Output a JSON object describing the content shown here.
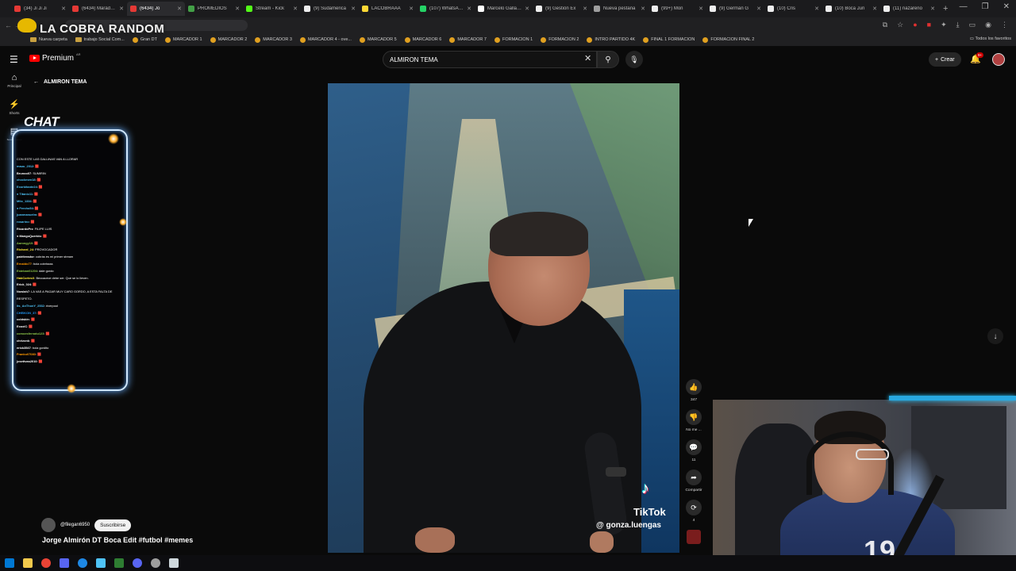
{
  "browser": {
    "tabs": [
      {
        "label": "(34) Ji Ji Ji",
        "color": "#e53935",
        "active": false
      },
      {
        "label": "(6434) Maradona",
        "color": "#e53935",
        "active": false
      },
      {
        "label": "(6434) Jo",
        "color": "#e53935",
        "active": true
      },
      {
        "label": "PROMEDIOS",
        "color": "#43a047",
        "active": false
      },
      {
        "label": "Stream - Kick",
        "color": "#53fc18",
        "active": false
      },
      {
        "label": "(9) Sudamerica",
        "color": "#eeeeee",
        "active": false
      },
      {
        "label": "LACOBRAAA",
        "color": "#fdd835",
        "active": false
      },
      {
        "label": "(107) WhatsApp",
        "color": "#25d366",
        "active": false
      },
      {
        "label": "Marcelo Gallardo",
        "color": "#ffffff",
        "active": false
      },
      {
        "label": "(9) Gestión Ex",
        "color": "#eeeeee",
        "active": false
      },
      {
        "label": "Nueva pestaña",
        "color": "#9e9e9e",
        "active": false
      },
      {
        "label": "(99+) Mon",
        "color": "#eeeeee",
        "active": false
      },
      {
        "label": "(9) Germán G",
        "color": "#eeeeee",
        "active": false
      },
      {
        "label": "(10) Cris",
        "color": "#eeeeee",
        "active": false
      },
      {
        "label": "(10) Boca Jun",
        "color": "#eeeeee",
        "active": false
      },
      {
        "label": "(11) nazareno",
        "color": "#eeeeee",
        "active": false
      }
    ],
    "new_tab": "+",
    "window_controls": [
      "—",
      "❐",
      "✕"
    ],
    "bookmarks": [
      {
        "label": "Nueva carpeta",
        "type": "folder"
      },
      {
        "label": "trabajo Social Com...",
        "type": "folder"
      },
      {
        "label": "Gran DT",
        "type": "site"
      },
      {
        "label": "MARCADOR 1",
        "type": "site"
      },
      {
        "label": "MARCADOR 2",
        "type": "site"
      },
      {
        "label": "MARCADOR 3",
        "type": "site"
      },
      {
        "label": "MARCADOR 4 - ove...",
        "type": "site"
      },
      {
        "label": "MARCADOR 5",
        "type": "site"
      },
      {
        "label": "MARCADOR 6",
        "type": "site"
      },
      {
        "label": "MARCADOR 7",
        "type": "site"
      },
      {
        "label": "FORMACION 1",
        "type": "site"
      },
      {
        "label": "FORMACION 2",
        "type": "site"
      },
      {
        "label": "INTRO PARTIDO 4K",
        "type": "site"
      },
      {
        "label": "FINAL 1 FORMACION",
        "type": "site"
      },
      {
        "label": "FORMACION FINAL 2",
        "type": "site"
      }
    ],
    "all_bookmarks": "Todos los favoritos"
  },
  "overlay": {
    "stream_title": "LA COBRA RANDOM",
    "chat_label": "CHAT",
    "chat_messages": [
      {
        "user": "",
        "text": "CON ESTE LAS GALLINAS VAN A LLORAR",
        "color": "#ffffff"
      },
      {
        "user": "mauu_2012",
        "text": ": 🟥",
        "color": "#4fc3f7"
      },
      {
        "user": "Brunoo07",
        "text": ": SUMIRIN",
        "color": "#ffffff"
      },
      {
        "user": "chockmen18",
        "text": ": 🟥",
        "color": "#4fc3f7"
      },
      {
        "user": "Exorbitante24",
        "text": ": 🟥",
        "color": "#4fc3f7"
      },
      {
        "user": "● Titanic11",
        "text": ": 🟥",
        "color": "#4fc3f7"
      },
      {
        "user": "Milo_1334",
        "text": ": 🟥",
        "color": "#4fc3f7"
      },
      {
        "user": "● Fercho54",
        "text": ": 🟥",
        "color": "#4fc3f7"
      },
      {
        "user": "juanmanuelm",
        "text": ": 🟥",
        "color": "#4fc3f7"
      },
      {
        "user": "rosarino",
        "text": ": 🟥",
        "color": "#4fc3f7"
      },
      {
        "user": "RicardoPrz",
        "text": ": FILIPE LUIS",
        "color": "#ffffff"
      },
      {
        "user": "● MangoQuerido",
        "text": ": 🟥",
        "color": "#ffffff"
      },
      {
        "user": "Aarongy10",
        "text": ": 🟥",
        "color": "#8bc34a"
      },
      {
        "user": "Richard_24",
        "text": ": PROVOCADOR",
        "color": "#ffeb3b"
      },
      {
        "user": "patriterador",
        "text": ": cobrás es mi primer stream",
        "color": "#ffffff"
      },
      {
        "user": "Ernaldo77",
        "text": ": bola cobrissss",
        "color": "#ff9800"
      },
      {
        "user": "Esteban01204",
        "text": ": dale gordo",
        "color": "#8bc34a"
      },
      {
        "user": "HabCortesX",
        "text": ": Beccacece debe ser. Que se lo lleven.",
        "color": "#ffeb3b"
      },
      {
        "user": "Erick_024",
        "text": ": 🟥",
        "color": "#ffffff"
      },
      {
        "user": "Nowlah7",
        "text": ": LA VAS A PAGAR MUY CARO GORDO, A ESTA FALTA DE",
        "color": "#ffffff"
      },
      {
        "user": "",
        "text": "RESPETO.",
        "color": "#ffffff"
      },
      {
        "user": "its_AnThonY_2532",
        "text": ": riverpool",
        "color": "#4fc3f7"
      },
      {
        "user": "CHEIKON_37",
        "text": ": 🟥",
        "color": "#2196f3"
      },
      {
        "user": "coldskin",
        "text": ": 🟥",
        "color": "#ffffff"
      },
      {
        "user": "ExoxiC",
        "text": ": 🟥",
        "color": "#ffffff"
      },
      {
        "user": "comoesfernatu123",
        "text": ": 🟥",
        "color": "#8bc34a"
      },
      {
        "user": "chrizonk",
        "text": ": 🟥",
        "color": "#ffffff"
      },
      {
        "user": "erick3547",
        "text": ": bola gordito",
        "color": "#ffffff"
      },
      {
        "user": "Franko07080",
        "text": ": 🟥",
        "color": "#ff9800"
      },
      {
        "user": "josettvas2010",
        "text": ": 🟥",
        "color": "#ffffff"
      }
    ]
  },
  "youtube": {
    "logo_text": "Premium",
    "region": "AR",
    "search_value": "ALMIRON TEMA",
    "create_label": "Crear",
    "notif_count": "9+",
    "nav": [
      {
        "label": "Principal",
        "icon": "home-icon"
      },
      {
        "label": "Shorts",
        "icon": "shorts-icon"
      },
      {
        "label": "Suscripciones",
        "icon": "subscriptions-icon"
      }
    ],
    "back_title": "ALMIRON TEMA",
    "short": {
      "watermark_brand": "TikTok",
      "watermark_user": "@ gonza.luengas",
      "channel": "@filegan6950",
      "subscribe_label": "Suscribirse",
      "title": "Jorge Almirón DT Boca Edit #futbol #memes",
      "likes": "347",
      "dislike_label": "No me ...",
      "comments": "11",
      "share_label": "Compartir",
      "remix": "4"
    }
  },
  "webcam": {
    "jersey_number": "19"
  }
}
